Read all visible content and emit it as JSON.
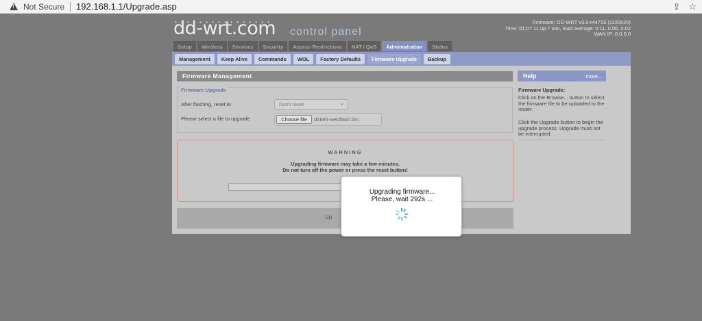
{
  "browser": {
    "security_label": "Not Secure",
    "url": "192.168.1.1/Upgrade.asp"
  },
  "header": {
    "logo": "dd-wrt.com",
    "control_panel": "control panel",
    "firmware_line": "Firmware: DD-WRT v3.0-r44715 (11/03/20)",
    "time_line": "Time: 01:07:11 up 7 min, load average: 0.11, 0.06, 0.02",
    "wan_line": "WAN IP: 0.0.0.0"
  },
  "tabs": [
    "Setup",
    "Wireless",
    "Services",
    "Security",
    "Access Restrictions",
    "NAT / QoS",
    "Administration",
    "Status"
  ],
  "subtabs": [
    "Management",
    "Keep Alive",
    "Commands",
    "WOL",
    "Factory Defaults",
    "Firmware Upgrade",
    "Backup"
  ],
  "main": {
    "section_title": "Firmware Management",
    "legend": "Firmware Upgrade",
    "reset_label": "After flashing, reset to",
    "reset_value": "Don't reset",
    "file_label": "Please select a file to upgrade",
    "choose_file": "Choose file",
    "file_name": "dir885-webflash.bin",
    "warning_title": "WARNING",
    "warning_line1": "Upgrading firmware may take a few minutes.",
    "warning_line2": "Do not turn off the power or press the reset button!",
    "upgrade_button": "Up"
  },
  "help": {
    "title": "Help",
    "more": "more...",
    "heading": "Firmware Upgrade:",
    "p1": "Click on the Browse... button to select the firmware file to be uploaded to the router.",
    "p2": "Click the Upgrade button to begin the upgrade process. Upgrade must not be interrupted."
  },
  "modal": {
    "line1": "Upgrading firmware...",
    "line2": "Please, wait 292s ..."
  },
  "colors": {
    "accent": "#8d9ac6",
    "spinner": "#3aa3d8"
  }
}
